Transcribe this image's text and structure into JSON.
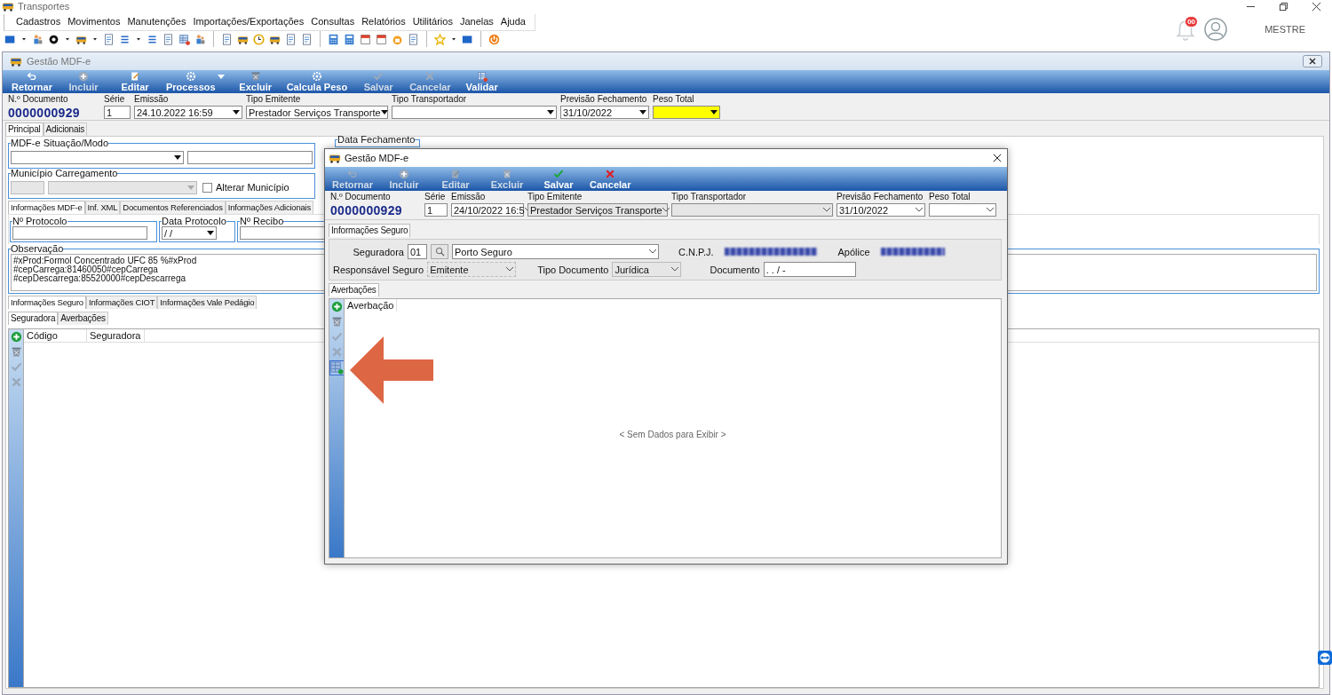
{
  "app": {
    "title": "Transportes",
    "notification_count": "00",
    "user": "MESTRE"
  },
  "menu": [
    {
      "label": "Cadastros"
    },
    {
      "label": "Movimentos"
    },
    {
      "label": "Manutenções"
    },
    {
      "label": "Importações/Exportações"
    },
    {
      "label": "Consultas"
    },
    {
      "label": "Relatórios"
    },
    {
      "label": "Utilitários"
    },
    {
      "label": "Janelas"
    },
    {
      "label": "Ajuda"
    }
  ],
  "window": {
    "title": "Gestão MDF-e",
    "toolbar": [
      {
        "label": "Retornar",
        "disabled": false
      },
      {
        "label": "Incluir",
        "disabled": true
      },
      {
        "label": "Editar",
        "disabled": false
      },
      {
        "label": "Processos",
        "disabled": false
      },
      {
        "label": "Excluir",
        "disabled": false
      },
      {
        "label": "Calcula Peso",
        "disabled": false
      },
      {
        "label": "Salvar",
        "disabled": true
      },
      {
        "label": "Cancelar",
        "disabled": true
      },
      {
        "label": "Validar",
        "disabled": false
      }
    ],
    "header": [
      {
        "kind": "number",
        "label": "N.º Documento",
        "value": "0000000929",
        "highlighted": false
      },
      {
        "kind": "text",
        "label": "Série",
        "value": "1",
        "highlighted": false
      },
      {
        "kind": "combo",
        "label": "Emissão",
        "value": "24.10.2022 16:59",
        "highlighted": false
      },
      {
        "kind": "combo",
        "label": "Tipo Emitente",
        "value": "Prestador Serviços Transporte",
        "highlighted": false
      },
      {
        "kind": "combo",
        "label": "Tipo Transportador",
        "highlighted": false
      },
      {
        "kind": "combo",
        "label": "Previsão Fechamento",
        "value": "31/10/2022",
        "highlighted": false
      },
      {
        "kind": "combo",
        "label": "Peso Total",
        "highlighted": true
      }
    ],
    "main_tabs": [
      {
        "label": "Principal",
        "selected": true
      },
      {
        "label": "Adicionais",
        "selected": false
      }
    ],
    "situacao": {
      "label": "MDF-e Situação/Modo"
    },
    "data_fechamento": {
      "label": "Data Fechamento"
    },
    "municipio": {
      "label": "Município Carregamento",
      "checkbox": {
        "label": "Alterar Município",
        "checked": false
      }
    },
    "info_tabs": [
      {
        "label": "Informações MDF-e",
        "selected": true
      },
      {
        "label": "Inf. XML",
        "selected": false
      },
      {
        "label": "Documentos Referenciados",
        "selected": false
      },
      {
        "label": "Informações Adicionais",
        "selected": false
      }
    ],
    "protocolo": {
      "label": "Nº Protocolo"
    },
    "data_protocolo": {
      "label": "Data Protocolo",
      "value": "/ /"
    },
    "recibo": {
      "label": "Nº Recibo"
    },
    "observacao": {
      "label": "Observação",
      "lines": [
        "#xProd:Formol Concentrado UFC 85 %#xProd",
        "#cepCarrega:81460050#cepCarrega",
        "#cepDescarrega:85520000#cepDescarrega"
      ]
    },
    "seguro_tabs": [
      {
        "label": "Informações Seguro",
        "selected": true
      },
      {
        "label": "Informações CIOT",
        "selected": false
      },
      {
        "label": "Informações Vale Pedágio",
        "selected": false
      }
    ],
    "sub_tabs": [
      {
        "label": "Seguradora",
        "selected": true
      },
      {
        "label": "Averbações",
        "selected": false
      }
    ],
    "grid": {
      "columns": [
        "Código",
        "Seguradora"
      ],
      "tools": [
        {
          "disabled": false
        },
        {
          "disabled": false
        },
        {
          "disabled": true
        },
        {
          "disabled": true
        }
      ]
    }
  },
  "dialog": {
    "title": "Gestão MDF-e",
    "toolbar": [
      {
        "label": "Retornar",
        "disabled": true
      },
      {
        "label": "Incluir",
        "disabled": true
      },
      {
        "label": "Editar",
        "disabled": true
      },
      {
        "label": "Excluir",
        "disabled": true
      },
      {
        "label": "Salvar",
        "disabled": false
      },
      {
        "label": "Cancelar",
        "disabled": false
      }
    ],
    "header": [
      {
        "kind": "number",
        "label": "N.º Documento",
        "value": "0000000929",
        "disabled": false
      },
      {
        "kind": "text",
        "label": "Série",
        "value": "1",
        "disabled": false
      },
      {
        "kind": "combo",
        "label": "Emissão",
        "value": "24/10/2022 16:5",
        "disabled": false
      },
      {
        "kind": "combo",
        "label": "Tipo Emitente",
        "value": "Prestador Serviços Transporte",
        "disabled": true
      },
      {
        "kind": "combo",
        "label": "Tipo Transportador",
        "disabled": true
      },
      {
        "kind": "combo",
        "label": "Previsão Fechamento",
        "value": "31/10/2022",
        "disabled": false
      },
      {
        "kind": "combo",
        "label": "Peso Total",
        "disabled": false
      }
    ],
    "tabs": [
      {
        "label": "Informações Seguro",
        "selected": true
      }
    ],
    "seguradora": {
      "label": "Seguradora",
      "code": "01",
      "name": "Porto Seguro"
    },
    "cnpj": {
      "label": "C.N.P.J."
    },
    "apolice": {
      "label": "Apólice"
    },
    "responsavel": {
      "label": "Responsável Seguro",
      "value": "Emitente"
    },
    "tipo_documento": {
      "label": "Tipo Documento",
      "value": "Jurídica"
    },
    "documento": {
      "label": "Documento",
      "value": ". . / -"
    },
    "sub_tabs": [
      {
        "label": "Averbações",
        "selected": true
      }
    ],
    "grid": {
      "columns": [
        "Averbação"
      ],
      "empty_text": "< Sem Dados para Exibir >",
      "tools": [
        {
          "disabled": false,
          "selected": false
        },
        {
          "disabled": false,
          "selected": false
        },
        {
          "disabled": true,
          "selected": false
        },
        {
          "disabled": true,
          "selected": false
        },
        {
          "disabled": false,
          "selected": true
        }
      ]
    }
  }
}
